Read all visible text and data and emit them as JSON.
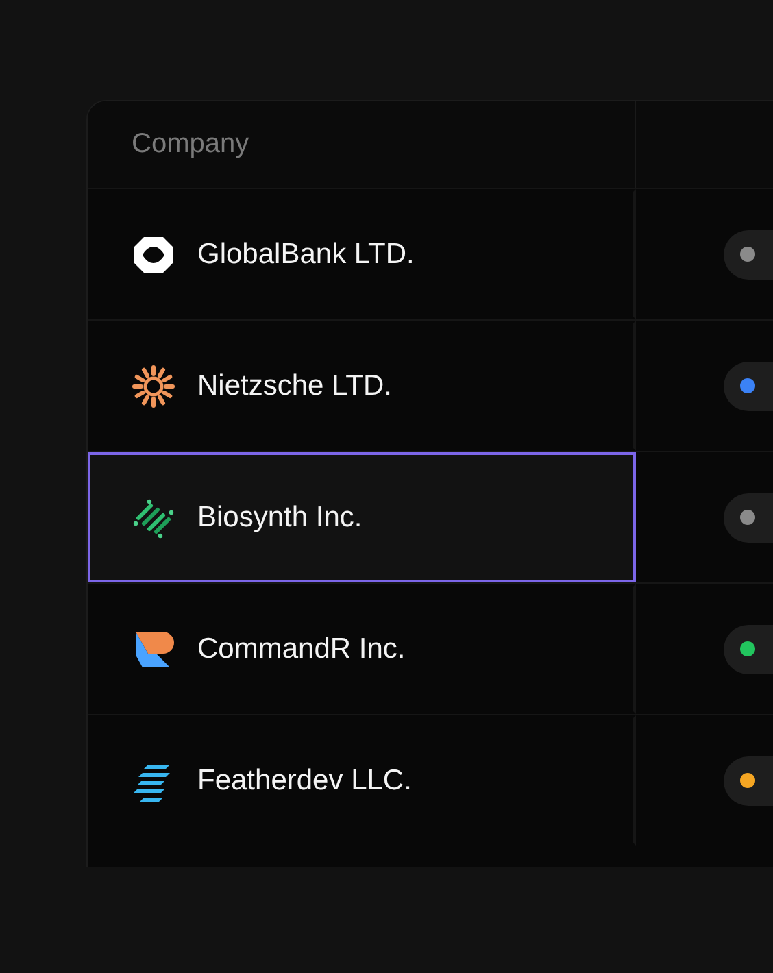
{
  "table": {
    "columns": [
      {
        "label": "Company"
      }
    ],
    "rows": [
      {
        "company": "GlobalBank LTD.",
        "logo": {
          "kind": "globalbank"
        },
        "selected": false,
        "status": {
          "color": "#8a8a8a"
        }
      },
      {
        "company": "Nietzsche LTD.",
        "logo": {
          "kind": "nietzsche"
        },
        "selected": false,
        "status": {
          "color": "#3b82f6"
        }
      },
      {
        "company": "Biosynth Inc.",
        "logo": {
          "kind": "biosynth"
        },
        "selected": true,
        "status": {
          "color": "#8a8a8a"
        }
      },
      {
        "company": "CommandR Inc.",
        "logo": {
          "kind": "commandr"
        },
        "selected": false,
        "status": {
          "color": "#22c55e"
        }
      },
      {
        "company": "Featherdev LLC.",
        "logo": {
          "kind": "featherdev"
        },
        "selected": false,
        "status": {
          "color": "#f5a623"
        }
      }
    ]
  }
}
